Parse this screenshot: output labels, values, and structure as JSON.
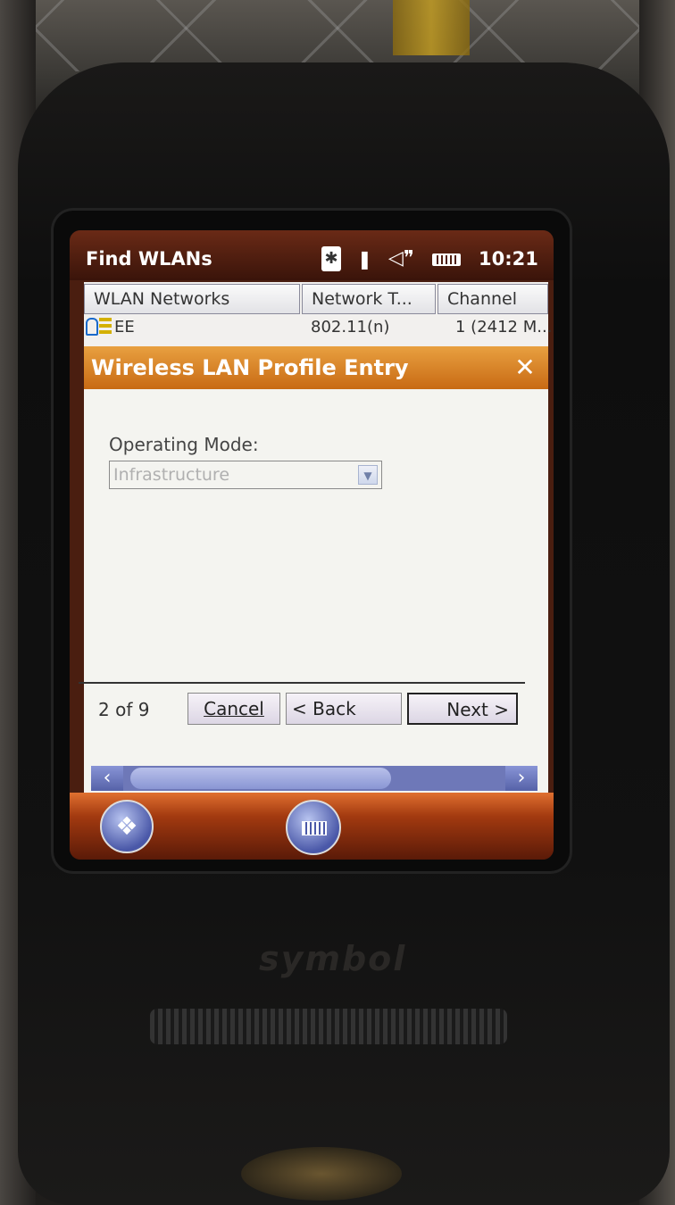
{
  "window": {
    "title": "Find WLANs",
    "clock": "10:21"
  },
  "status_icons": [
    "bluetooth-icon",
    "antenna-icon",
    "speaker-icon",
    "battery-icon"
  ],
  "wlan_list": {
    "columns": [
      "WLAN Networks",
      "Network T...",
      "Channel"
    ],
    "rows": [
      {
        "name": "EE",
        "network_type": "802.11(n)",
        "channel": "1 (2412 M..."
      }
    ]
  },
  "dialog": {
    "title": "Wireless LAN Profile Entry",
    "close_label": "✕",
    "operating_mode_label": "Operating Mode:",
    "operating_mode_value": "Infrastructure",
    "page_count": "2 of 9",
    "cancel_label": "Cancel",
    "back_label": "< Back",
    "next_label": "Next >"
  },
  "taskbar": {
    "start_icon": "windows-logo-icon",
    "keyboard_icon": "keyboard-icon"
  },
  "device": {
    "brand": "symbol"
  },
  "colors": {
    "dialog_header": "#d88428",
    "title_bar": "#5a2212",
    "scrollbar": "#6e78b8"
  }
}
